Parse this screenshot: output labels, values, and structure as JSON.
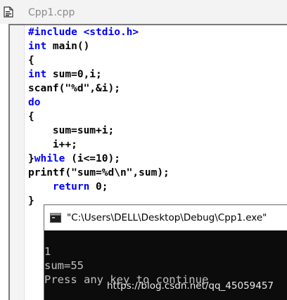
{
  "editor": {
    "file_title": "Cpp1.cpp",
    "code_lines": [
      [
        {
          "t": "#include <stdio.h>",
          "kw": true
        }
      ],
      [
        {
          "t": "int",
          "kw": true
        },
        {
          "t": " main()",
          "kw": false
        }
      ],
      [
        {
          "t": "{",
          "kw": false
        }
      ],
      [
        {
          "t": "int",
          "kw": true
        },
        {
          "t": " sum=0,i;",
          "kw": false
        }
      ],
      [
        {
          "t": "scanf(\"%d\",&i);",
          "kw": false
        }
      ],
      [
        {
          "t": "do",
          "kw": true
        }
      ],
      [
        {
          "t": "{",
          "kw": false
        }
      ],
      [
        {
          "t": "    sum=sum+i;",
          "kw": false
        }
      ],
      [
        {
          "t": "    i++;",
          "kw": false
        }
      ],
      [
        {
          "t": "}",
          "kw": false
        },
        {
          "t": "while",
          "kw": true
        },
        {
          "t": " (i<=10);",
          "kw": false
        }
      ],
      [
        {
          "t": "printf(\"sum=%d\\n\",sum);",
          "kw": false
        }
      ],
      [
        {
          "t": "    ",
          "kw": false
        },
        {
          "t": "return",
          "kw": true
        },
        {
          "t": " 0;",
          "kw": false
        }
      ],
      [
        {
          "t": "}",
          "kw": false
        }
      ]
    ]
  },
  "console": {
    "title": "\"C:\\Users\\DELL\\Desktop\\Debug\\Cpp1.exe\"",
    "lines": [
      "1",
      "sum=55",
      "Press any key to continue"
    ]
  },
  "watermark": "https://blog.csdn.net/qq_45059457",
  "colors": {
    "keyword": "#0000ff",
    "code_text": "#000000",
    "console_bg": "#0c0c0c",
    "console_text": "#c0c0c0",
    "editor_title": "#8a8a8a"
  },
  "icons": {
    "file": "cpp-source-file-icon",
    "console": "console-window-icon"
  }
}
